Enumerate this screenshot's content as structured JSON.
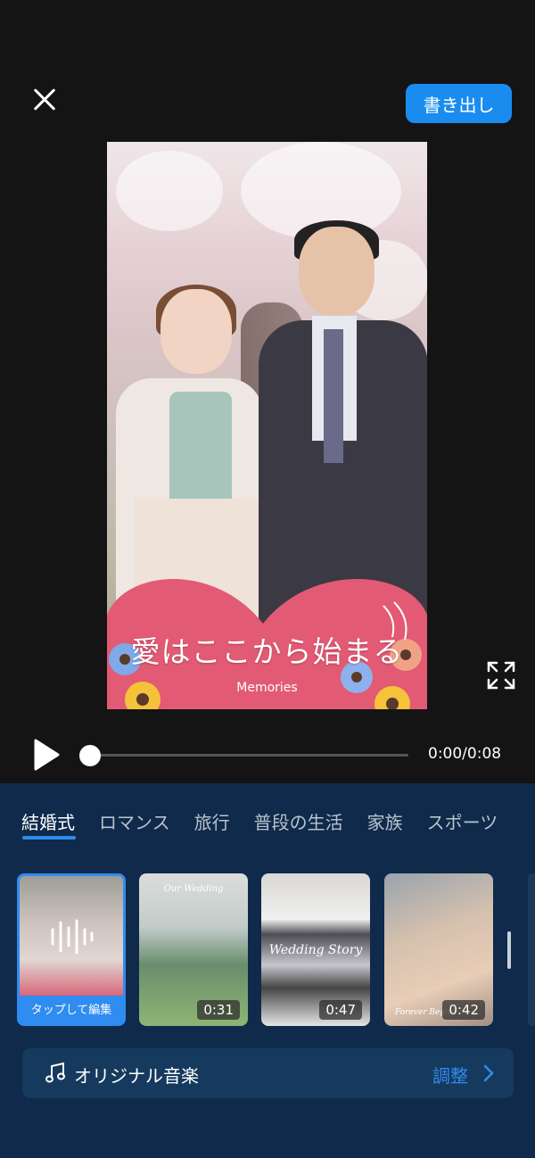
{
  "header": {
    "export_label": "書き出し"
  },
  "preview": {
    "caption": "愛はここから始まる",
    "subcaption": "Memories"
  },
  "playback": {
    "time": "0:00/0:08",
    "progress": 0.0
  },
  "tabs": [
    {
      "label": "結婚式",
      "active": true
    },
    {
      "label": "ロマンス",
      "active": false
    },
    {
      "label": "旅行",
      "active": false
    },
    {
      "label": "普段の生活",
      "active": false
    },
    {
      "label": "家族",
      "active": false
    },
    {
      "label": "スポーツ",
      "active": false
    }
  ],
  "templates": [
    {
      "label": "タップして編集",
      "selected": true
    },
    {
      "title": "Our Wedding",
      "duration": "0:31"
    },
    {
      "title": "Wedding Story",
      "duration": "0:47"
    },
    {
      "title": "Forever Begins",
      "duration": "0:42"
    }
  ],
  "music": {
    "label": "オリジナル音楽",
    "action": "調整"
  },
  "colors": {
    "accent": "#2f8cf0",
    "panel": "#0f2a4a",
    "heart": "#e35a74"
  }
}
